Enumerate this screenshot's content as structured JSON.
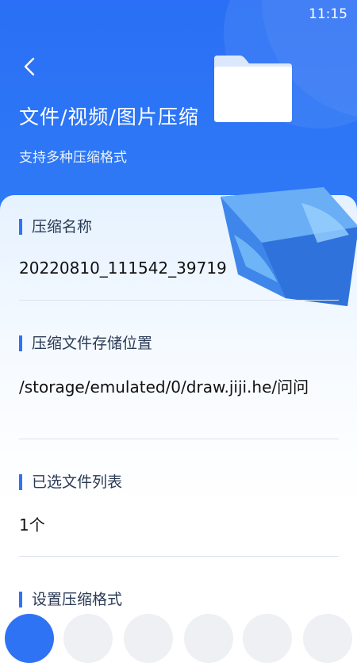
{
  "status_bar": {
    "time": "11:15"
  },
  "header": {
    "title": "文件/视频/图片压缩",
    "subtitle": "支持多种压缩格式",
    "back_icon": "chevron-left-icon",
    "illustration_icon": "folder-icon"
  },
  "form": {
    "name": {
      "label": "压缩名称",
      "value": "20220810_111542_39719"
    },
    "location": {
      "label": "压缩文件存储位置",
      "value": "/storage/emulated/0/draw.jiji.he/问问"
    },
    "files": {
      "label": "已选文件列表",
      "value": "1个"
    },
    "format": {
      "label": "设置压缩格式"
    }
  },
  "colors": {
    "accent": "#2f73f5",
    "header_bg": "#2a6ff5"
  }
}
